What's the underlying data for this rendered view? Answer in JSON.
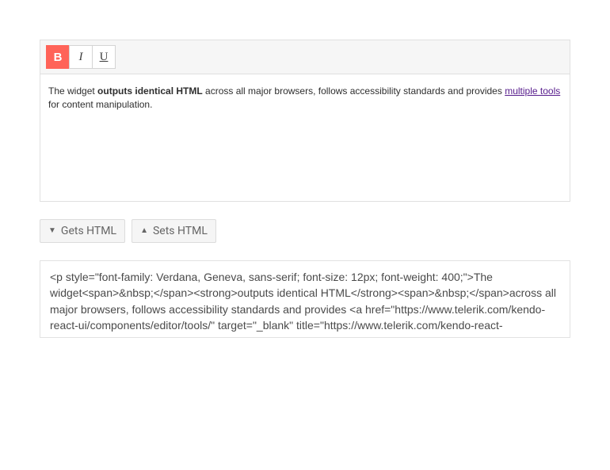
{
  "toolbar": {
    "bold_label": "B",
    "italic_label": "I",
    "underline_label": "U",
    "bold_active": true
  },
  "editor": {
    "text_prefix": "The widget ",
    "text_bold": "outputs identical HTML",
    "text_middle": " across all major browsers, follows accessibility standards and provides ",
    "link_text": "multiple tools",
    "text_suffix": " for content manipulation."
  },
  "buttons": {
    "gets_html_label": "Gets HTML",
    "sets_html_label": "Sets HTML"
  },
  "output": {
    "html_source": "<p style=\"font-family: Verdana, Geneva, sans-serif; font-size: 12px; font-weight: 400;\">The widget<span>&nbsp;</span><strong>outputs identical HTML</strong><span>&nbsp;</span>across all major browsers, follows accessibility standards and provides <a href=\"https://www.telerik.com/kendo-react-ui/components/editor/tools/\" target=\"_blank\" title=\"https://www.telerik.com/kendo-react-ui/components/editor/tools/\">multiple tools</a> for content manipulation.</p>"
  }
}
